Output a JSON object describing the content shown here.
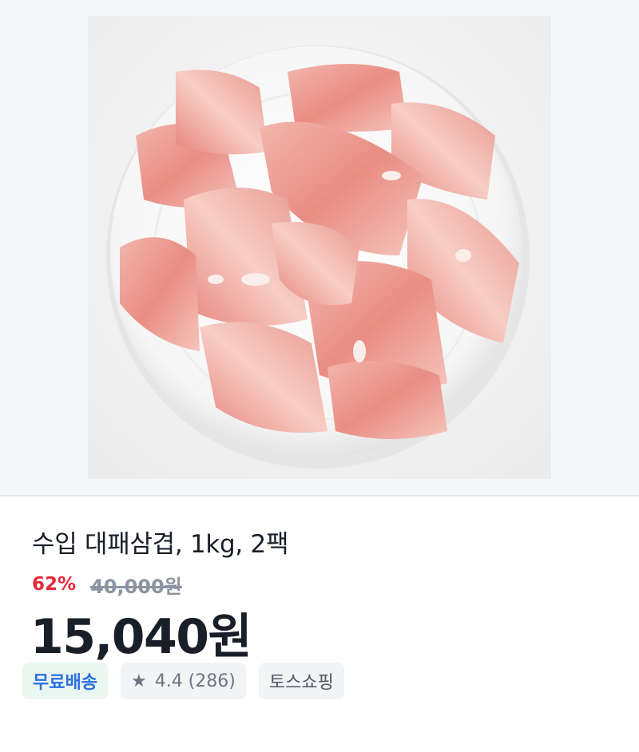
{
  "product": {
    "image_alt": "",
    "title": "수입 대패삼겹, 1kg, 2팩",
    "discount_rate": "62%",
    "original_price": "40,000원",
    "sale_price": "15,040원"
  },
  "badges": {
    "shipping": "무료배송",
    "rating_icon": "star-icon",
    "rating": "4.4 (286)",
    "store": "토스쇼핑"
  },
  "colors": {
    "discount": "#e42939",
    "shipping_text": "#2b6fe0",
    "shipping_bg": "#e9f7f0",
    "title": "#191f28"
  }
}
